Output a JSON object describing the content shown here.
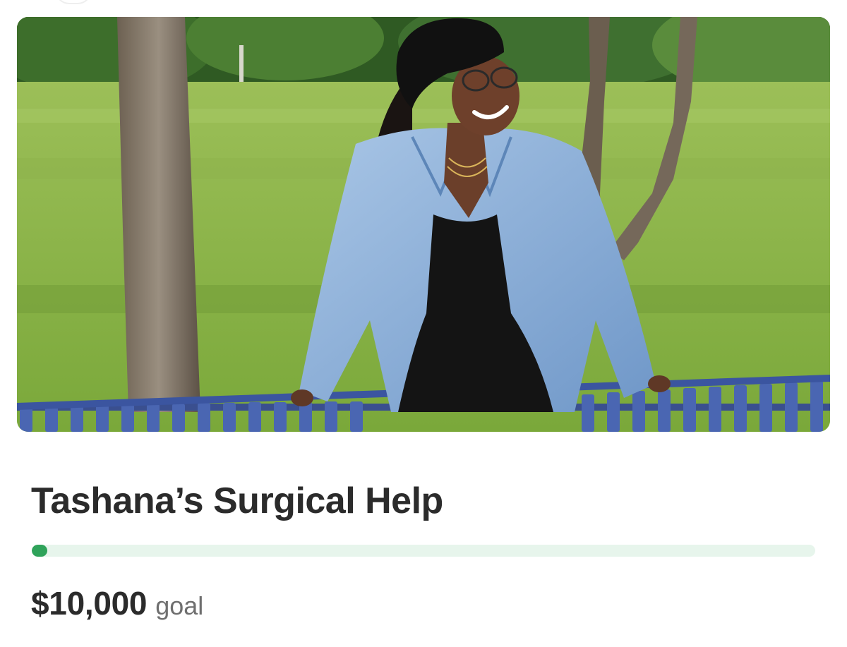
{
  "campaign": {
    "title": "Tashana’s Surgical Help",
    "goal_amount": "$10,000",
    "goal_label": "goal",
    "progress_fraction": 0.01
  },
  "colors": {
    "progress_fill": "#2fa35a",
    "progress_track": "#e7f5ec",
    "title_text": "#2b2b2b",
    "secondary_text": "#6f6f6f"
  }
}
